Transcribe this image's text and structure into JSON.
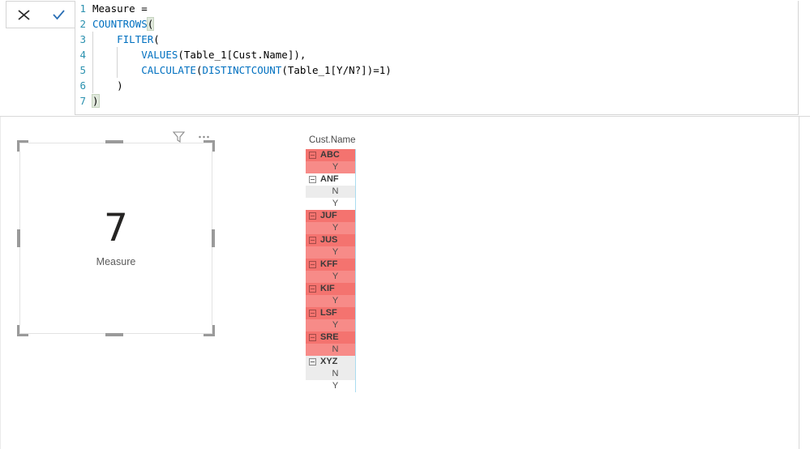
{
  "formula_bar": {
    "cancel_label": "cancel-formula",
    "commit_label": "commit-formula",
    "lines": [
      {
        "num": "1",
        "text": "Measure ="
      },
      {
        "num": "2",
        "text": "COUNTROWS("
      },
      {
        "num": "3",
        "text": "    FILTER("
      },
      {
        "num": "4",
        "text": "        VALUES(Table_1[Cust.Name]),"
      },
      {
        "num": "5",
        "text": "        CALCULATE(DISTINCTCOUNT(Table_1[Y/N?])=1)"
      },
      {
        "num": "6",
        "text": "    )"
      },
      {
        "num": "7",
        "text": ")"
      }
    ],
    "measure_name": "Measure =",
    "functions": [
      "COUNTROWS",
      "FILTER",
      "VALUES",
      "CALCULATE",
      "DISTINCTCOUNT"
    ],
    "table_ref": "Table_1",
    "columns_ref": [
      "Cust.Name",
      "Y/N?"
    ],
    "literal": "1",
    "keyword_color": "#0070c0",
    "gutter_color": "#2b91af"
  },
  "card_visual": {
    "value": "7",
    "label": "Measure",
    "filter_icon": "filter-funnel-icon",
    "more_icon": "more-options-icon"
  },
  "data_table": {
    "column_header": "Cust.Name",
    "highlight_color": "#f4736f",
    "highlight_value_color": "#f78b88",
    "groups": [
      {
        "name": "ABC",
        "highlighted": true,
        "values": [
          "Y"
        ]
      },
      {
        "name": "ANF",
        "highlighted": false,
        "values": [
          "N",
          "Y"
        ]
      },
      {
        "name": "JUF",
        "highlighted": true,
        "values": [
          "Y"
        ]
      },
      {
        "name": "JUS",
        "highlighted": true,
        "values": [
          "Y"
        ]
      },
      {
        "name": "KFF",
        "highlighted": true,
        "values": [
          "Y"
        ]
      },
      {
        "name": "KIF",
        "highlighted": true,
        "values": [
          "Y"
        ]
      },
      {
        "name": "LSF",
        "highlighted": true,
        "values": [
          "Y"
        ]
      },
      {
        "name": "SRE",
        "highlighted": true,
        "values": [
          "N"
        ]
      },
      {
        "name": "XYZ",
        "highlighted": false,
        "values": [
          "N",
          "Y"
        ]
      }
    ]
  }
}
